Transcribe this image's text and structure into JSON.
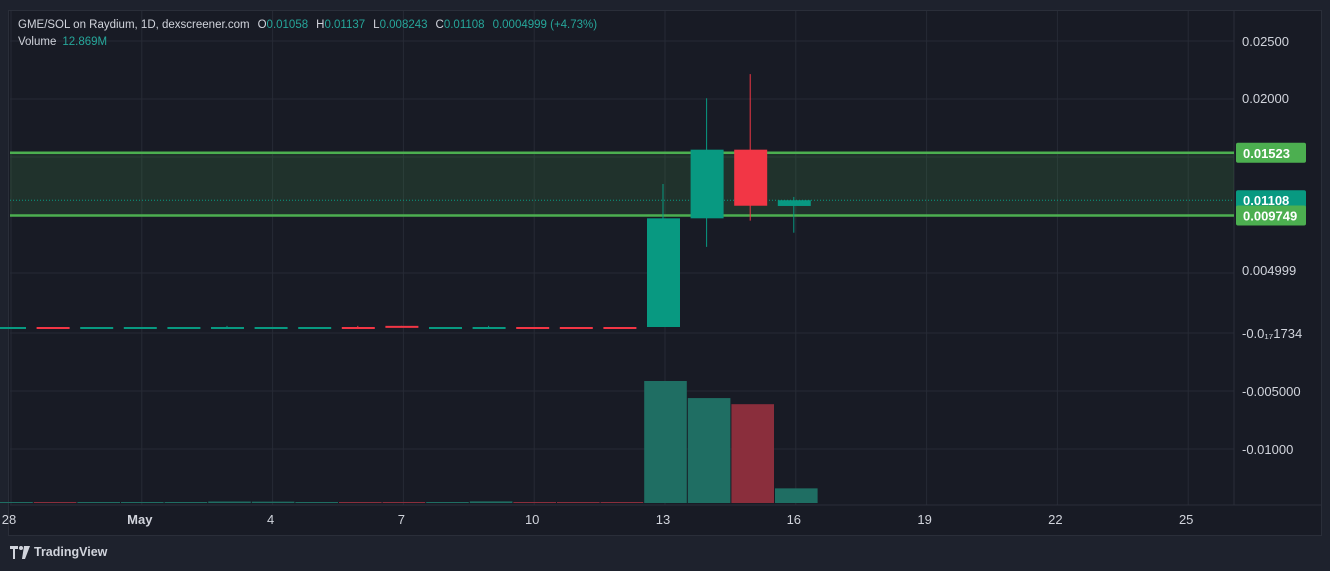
{
  "legend": {
    "symbol": "GME/SOL on Raydium, 1D, dexscreener.com",
    "o_label": "O",
    "o_value": "0.01058",
    "h_label": "H",
    "h_value": "0.01137",
    "l_label": "L",
    "l_value": "0.008243",
    "c_label": "C",
    "c_value": "0.01108",
    "change": "0.0004999 (+4.73%)",
    "volume_label": "Volume",
    "volume_value": "12.869M"
  },
  "colors": {
    "up": "#089981",
    "down": "#f23645",
    "vol_up": "#1f6e63",
    "vol_down": "#8a2e3c",
    "zone": "#4caf50",
    "background": "#181b25",
    "grid": "#262a35"
  },
  "footer": {
    "brand": "TradingView",
    "logo_icon": "tradingview-logo-icon"
  },
  "chart_data": {
    "type": "candlestick",
    "x_ticks": [
      {
        "label": "28",
        "day": 0
      },
      {
        "label": "May",
        "day": 3
      },
      {
        "label": "4",
        "day": 6
      },
      {
        "label": "7",
        "day": 9
      },
      {
        "label": "10",
        "day": 12
      },
      {
        "label": "13",
        "day": 15
      },
      {
        "label": "16",
        "day": 18
      },
      {
        "label": "19",
        "day": 21
      },
      {
        "label": "22",
        "day": 24
      },
      {
        "label": "25",
        "day": 27
      }
    ],
    "price_ticks": [
      {
        "label": "0.02500",
        "value": 0.025
      },
      {
        "label": "0.02000",
        "value": 0.02
      },
      {
        "label": "0.004999",
        "value": 0.005
      }
    ],
    "price_ticks_low": [
      {
        "label": "-0.0₁₇1734",
        "frac": 0.0
      },
      {
        "label": "-0.005000",
        "frac": 0.25
      },
      {
        "label": "-0.01000",
        "frac": 0.5
      }
    ],
    "candles": [
      {
        "day": 0,
        "o": 0.0,
        "h": 0.0,
        "l": 0.0,
        "c": 0.0,
        "vol": 0.004
      },
      {
        "day": 1,
        "o": 0.0,
        "h": 0.0,
        "l": 0.0,
        "c": 0.0,
        "vol": 0.005
      },
      {
        "day": 2,
        "o": 0.0,
        "h": 0.0,
        "l": 0.0,
        "c": 0.0,
        "vol": 0.004
      },
      {
        "day": 3,
        "o": 0.0,
        "h": 0.0,
        "l": 0.0,
        "c": 0.0,
        "vol": 0.006
      },
      {
        "day": 4,
        "o": 0.0,
        "h": 0.0,
        "l": 0.0,
        "c": 0.0,
        "vol": 0.006
      },
      {
        "day": 5,
        "o": 0.0,
        "h": 0.0001,
        "l": 0.0,
        "c": 0.0,
        "vol": 0.012
      },
      {
        "day": 6,
        "o": 0.0,
        "h": 0.0,
        "l": 0.0,
        "c": 0.0,
        "vol": 0.011
      },
      {
        "day": 7,
        "o": 0.0,
        "h": 0.0,
        "l": 0.0,
        "c": 0.0,
        "vol": 0.005
      },
      {
        "day": 8,
        "o": 0.0,
        "h": 0.0001,
        "l": 0.0,
        "c": 0.0,
        "vol": 0.005
      },
      {
        "day": 9,
        "o": 0.0001,
        "h": 0.0001,
        "l": 0.0,
        "c": 0.0,
        "vol": 0.006
      },
      {
        "day": 10,
        "o": 0.0,
        "h": 0.0,
        "l": 0.0,
        "c": 0.0,
        "vol": 0.004
      },
      {
        "day": 11,
        "o": 0.0,
        "h": 0.0001,
        "l": 0.0,
        "c": 0.0,
        "vol": 0.013
      },
      {
        "day": 12,
        "o": 0.0,
        "h": 0.0,
        "l": 0.0,
        "c": 0.0,
        "vol": 0.005
      },
      {
        "day": 13,
        "o": 0.0,
        "h": 0.0,
        "l": 0.0,
        "c": 0.0,
        "vol": 0.004
      },
      {
        "day": 14,
        "o": 0.0,
        "h": 0.0,
        "l": 0.0,
        "c": 0.0,
        "vol": 0.003
      },
      {
        "day": 15,
        "o": 0.0,
        "h": 0.0125,
        "l": 0.0,
        "c": 0.0095,
        "vol": 1.0
      },
      {
        "day": 16,
        "o": 0.0095,
        "h": 0.02,
        "l": 0.007,
        "c": 0.0155,
        "vol": 0.86
      },
      {
        "day": 17,
        "o": 0.0155,
        "h": 0.0221,
        "l": 0.0093,
        "c": 0.0106,
        "vol": 0.81
      },
      {
        "day": 18,
        "o": 0.01058,
        "h": 0.01137,
        "l": 0.008243,
        "c": 0.01108,
        "vol": 0.12
      }
    ],
    "down_days": [
      1,
      8,
      9,
      12,
      13,
      14,
      17
    ],
    "zone": {
      "top": 0.01523,
      "bottom": 0.009749
    },
    "zone_labels": {
      "top": "0.01523",
      "bottom": "0.009749"
    },
    "last_price": {
      "value": 0.01108,
      "label": "0.01108"
    },
    "grid": true
  }
}
